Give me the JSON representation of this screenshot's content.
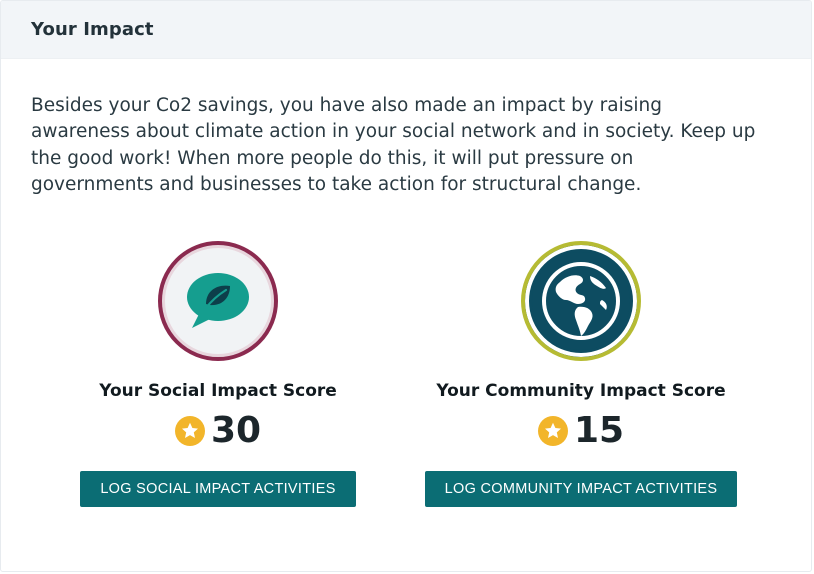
{
  "header": {
    "title": "Your Impact"
  },
  "intro": {
    "text": "Besides your Co2 savings, you have also made an impact by raising awareness about climate action in your social network and in society. Keep up the good work! When more people do this, it will put pressure on governments and businesses to take action for structural change."
  },
  "social": {
    "icon": "speech-bubble-leaf-icon",
    "label": "Your Social Impact Score",
    "score_icon": "star-icon",
    "score": "30",
    "button_label": "LOG SOCIAL IMPACT ACTIVITIES"
  },
  "community": {
    "icon": "globe-icon",
    "label": "Your Community Impact Score",
    "score_icon": "star-icon",
    "score": "15",
    "button_label": "LOG COMMUNITY IMPACT ACTIVITIES"
  },
  "colors": {
    "accent": "#0b6d74",
    "star": "#f2b52a",
    "social_ring": "#8b2a4f",
    "community_ring": "#b6bb33",
    "community_fill": "#0d4c61",
    "bubble": "#159e8f"
  }
}
